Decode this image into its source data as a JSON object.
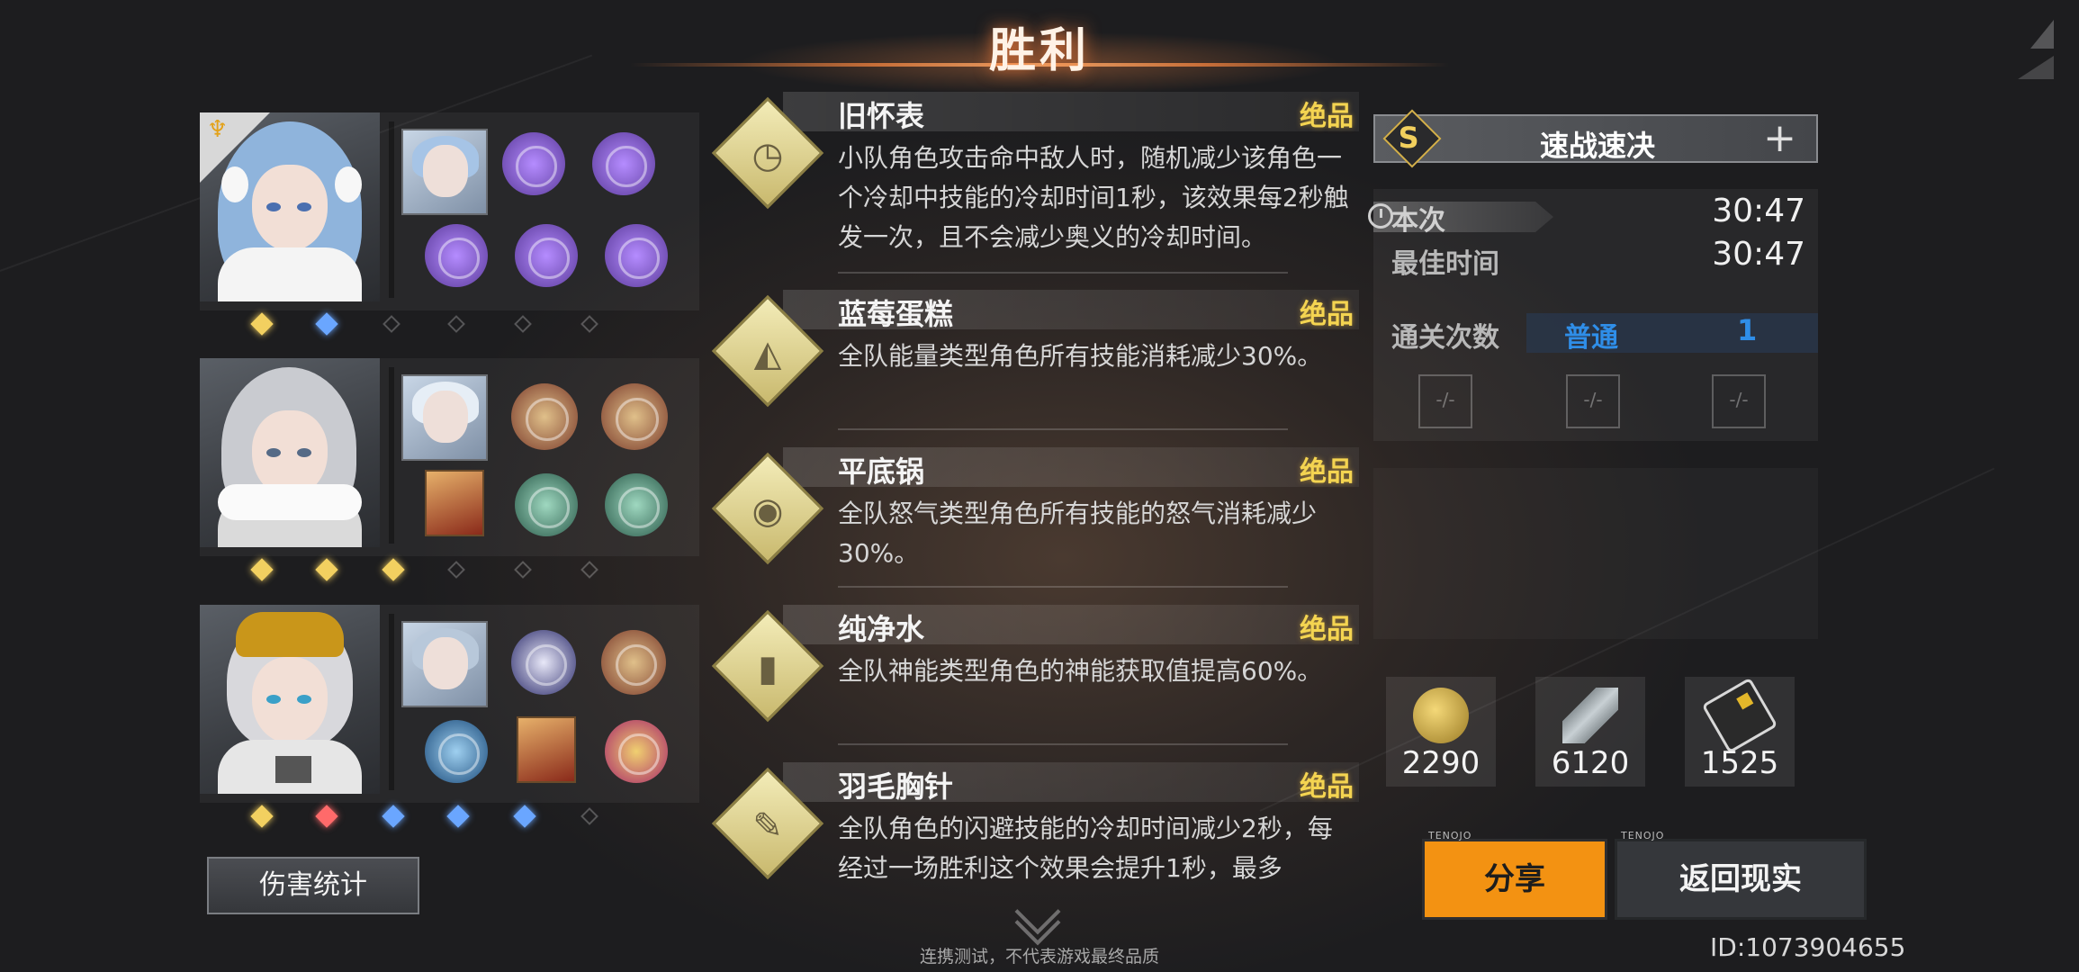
{
  "header": {
    "title": "胜利"
  },
  "characters": [
    {
      "stars": [
        "gold",
        "blue",
        "empty",
        "empty",
        "empty",
        "empty"
      ]
    },
    {
      "stars": [
        "gold",
        "gold",
        "gold",
        "empty",
        "empty",
        "empty"
      ]
    },
    {
      "stars": [
        "gold",
        "red",
        "blue",
        "blue",
        "blue",
        "empty"
      ]
    }
  ],
  "damage_button": "伤害统计",
  "relics": [
    {
      "name": "旧怀表",
      "grade": "绝品",
      "icon": "pocket-watch-icon",
      "desc": "小队角色攻击命中敌人时，随机减少该角色一个冷却中技能的冷却时间1秒，该效果每2秒触发一次，且不会减少奥义的冷却时间。"
    },
    {
      "name": "蓝莓蛋糕",
      "grade": "绝品",
      "icon": "cake-icon",
      "desc": "全队能量类型角色所有技能消耗减少30%。"
    },
    {
      "name": "平底锅",
      "grade": "绝品",
      "icon": "frying-pan-icon",
      "desc": "全队怒气类型角色所有技能的怒气消耗减少30%。"
    },
    {
      "name": "纯净水",
      "grade": "绝品",
      "icon": "water-bottle-icon",
      "desc": "全队神能类型角色的神能获取值提高60%。"
    },
    {
      "name": "羽毛胸针",
      "grade": "绝品",
      "icon": "feather-icon",
      "desc": "全队角色的闪避技能的冷却时间减少2秒，每经过一场胜利这个效果会提升1秒，最多"
    }
  ],
  "footnote": "连携测试，不代表游戏最终品质",
  "challenge": {
    "rank": "S",
    "name": "速战速决"
  },
  "stats": {
    "current_label": "本次",
    "current_value": "30:47",
    "best_label": "最佳时间",
    "best_value": "30:47",
    "clear_label": "通关次数",
    "clear_mode": "普通",
    "clear_count": "1",
    "empty_slot": "-/-"
  },
  "rewards": [
    {
      "icon": "coin-icon",
      "amount": "2290"
    },
    {
      "icon": "chain-icon",
      "amount": "6120"
    },
    {
      "icon": "chip-card-icon",
      "amount": "1525"
    }
  ],
  "buttons": {
    "share": "分享",
    "back": "返回现实",
    "tag": "TENOJO"
  },
  "player_id": "ID:1073904655",
  "colors": {
    "accent": "#f39212",
    "grade": "#f4d451",
    "blue": "#2f8ee8"
  }
}
